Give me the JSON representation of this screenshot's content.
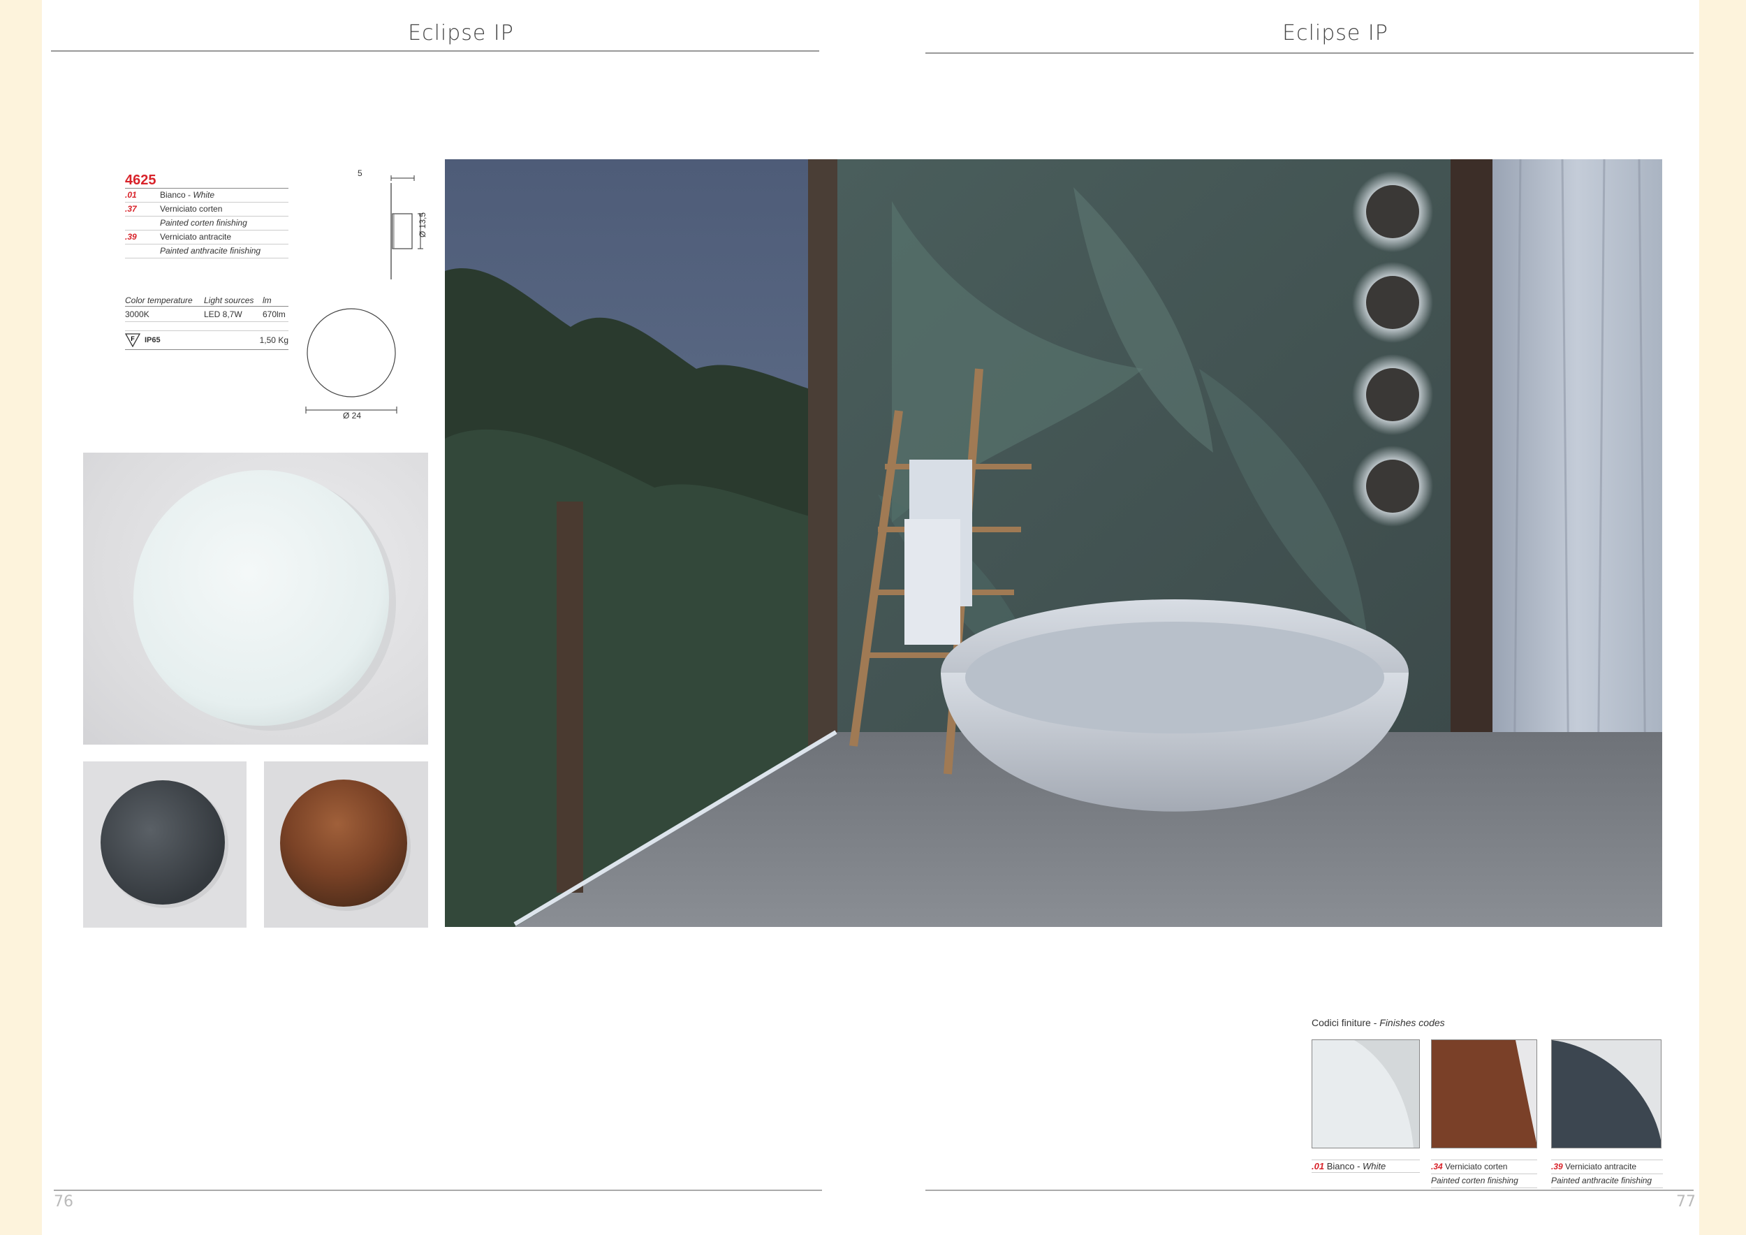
{
  "header": {
    "left_title": "Eclipse IP",
    "right_title": "Eclipse IP"
  },
  "spec": {
    "code": "4625",
    "finishes": [
      {
        "code": ".01",
        "it": "Bianco - ",
        "en": "White"
      },
      {
        "code": ".37",
        "it": "Verniciato corten",
        "en": ""
      },
      {
        "code": "",
        "it": "",
        "en": "Painted corten finishing"
      },
      {
        "code": ".39",
        "it": "Verniciato antracite",
        "en": ""
      },
      {
        "code": "",
        "it": "",
        "en": "Painted anthracite finishing"
      }
    ]
  },
  "tech": {
    "headers": [
      "Color temperature",
      "Light sources",
      "lm"
    ],
    "values": [
      "3000K",
      "LED 8,7W",
      "670lm"
    ],
    "cert_label": "F",
    "ip": "IP65",
    "weight": "1,50 Kg"
  },
  "dimensions": {
    "depth": "5",
    "height": "Ø 13,5",
    "diameter": "Ø 24"
  },
  "finishes_codes": {
    "title_it": "Codici finiture - ",
    "title_en": "Finishes codes",
    "swatches": [
      {
        "code": ".01",
        "it": "Bianco - ",
        "en": "White",
        "en2": "",
        "color": "#e8ecee"
      },
      {
        "code": ".34",
        "it": "Verniciato corten",
        "en": "",
        "en2": "Painted corten finishing",
        "color": "#7a4028"
      },
      {
        "code": ".39",
        "it": "Verniciato antracite",
        "en": "",
        "en2": "Painted anthracite finishing",
        "color": "#3c4650"
      }
    ]
  },
  "page_numbers": {
    "left": "76",
    "right": "77"
  },
  "colors": {
    "accent_red": "#d8232a",
    "page_bg": "#fdf3dc"
  }
}
